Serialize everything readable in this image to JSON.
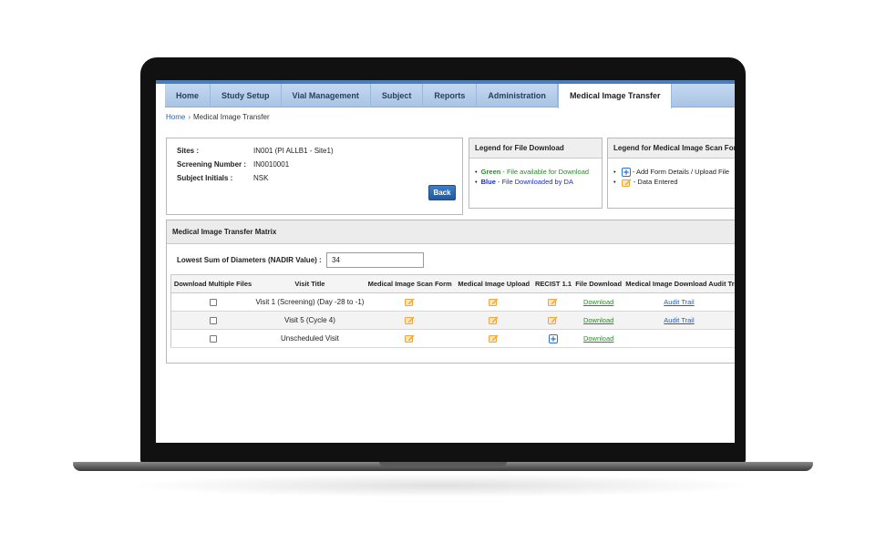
{
  "nav": {
    "items": [
      {
        "label": "Home"
      },
      {
        "label": "Study Setup"
      },
      {
        "label": "Vial Management"
      },
      {
        "label": "Subject"
      },
      {
        "label": "Reports"
      },
      {
        "label": "Administration"
      },
      {
        "label": "Medical Image Transfer",
        "active": true
      }
    ]
  },
  "breadcrumb": {
    "home": "Home",
    "separator": "›",
    "current": "Medical Image Transfer"
  },
  "subject": {
    "sites_label": "Sites :",
    "sites_value": "IN001 (PI ALLB1 - Site1)",
    "screening_label": "Screening Number :",
    "screening_value": "IN0010001",
    "initials_label": "Subject Initials :",
    "initials_value": "NSK",
    "back_label": "Back"
  },
  "legend_download": {
    "title": "Legend for File Download",
    "green_word": "Green",
    "green_text": " - File available for Download",
    "blue_word": "Blue",
    "blue_text": " - File Downloaded by DA",
    "green_color": "#2a8a2a",
    "blue_color": "#1a2fbf"
  },
  "legend_scan": {
    "title": "Legend for Medical Image Scan Form",
    "add_text": " - Add Form Details / Upload File",
    "entered_text": " - Data Entered"
  },
  "matrix": {
    "title": "Medical Image Transfer Matrix",
    "nadir_label": "Lowest Sum of Diameters (NADIR Value) :",
    "nadir_value": "34",
    "columns": [
      "Download Multiple Files",
      "Visit Title",
      "Medical Image Scan Form",
      "Medical Image Upload",
      "RECIST 1.1",
      "File Download",
      "Medical Image Download Audit Trail"
    ],
    "rows": [
      {
        "visit": "Visit 1 (Screening) (Day -28 to -1)",
        "recist_icon": "edit-icon",
        "download": "Download",
        "audit": "Audit Trail"
      },
      {
        "visit": "Visit 5 (Cycle 4)",
        "recist_icon": "edit-icon",
        "download": "Download",
        "audit": "Audit Trail"
      },
      {
        "visit": "Unscheduled Visit",
        "recist_icon": "add-icon",
        "download": "Download",
        "audit": ""
      }
    ]
  },
  "colors": {
    "accent": "#4a7ebb",
    "edit_icon": "#f0a43a",
    "add_icon": "#2b6fd6"
  }
}
